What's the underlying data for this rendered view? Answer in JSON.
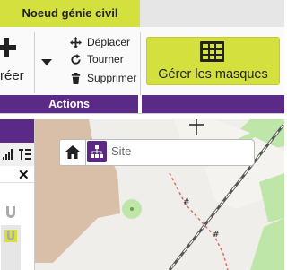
{
  "tabs": {
    "active_label": "Noeud génie civil"
  },
  "ribbon": {
    "actions_group": {
      "big_button_label": "réer",
      "commands": [
        {
          "label": "Déplacer",
          "icon": "move-arrows-icon"
        },
        {
          "label": "Tourner",
          "icon": "rotate-icon"
        },
        {
          "label": "Supprimer",
          "icon": "trash-icon"
        }
      ],
      "group_label": "Actions"
    },
    "masks_button": {
      "label": "Gérer les masques",
      "icon": "grid-table-icon"
    }
  },
  "search": {
    "placeholder": "Site",
    "icon": "hierarchy-icon"
  },
  "colors": {
    "accent": "#d4e03d",
    "brand": "#5b2a86"
  }
}
